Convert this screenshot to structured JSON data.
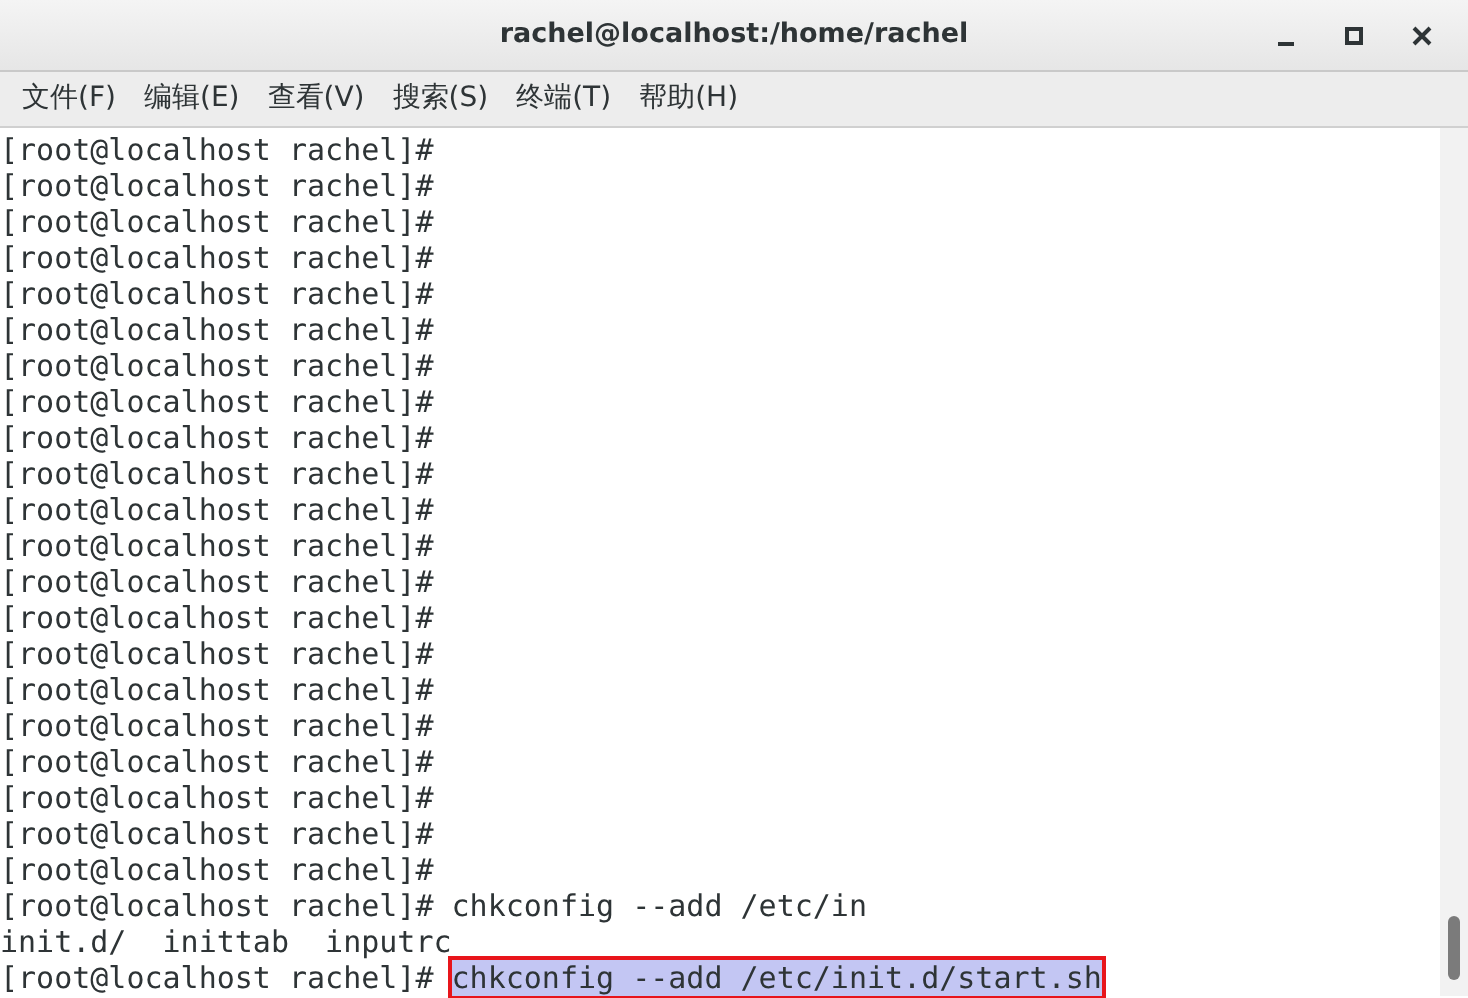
{
  "window": {
    "title": "rachel@localhost:/home/rachel"
  },
  "menu": [
    {
      "label": "文件(F)"
    },
    {
      "label": "编辑(E)"
    },
    {
      "label": "查看(V)"
    },
    {
      "label": "搜索(S)"
    },
    {
      "label": "终端(T)"
    },
    {
      "label": "帮助(H)"
    }
  ],
  "terminal": {
    "lines": [
      {
        "text": "[root@localhost rachel]#"
      },
      {
        "text": "[root@localhost rachel]#"
      },
      {
        "text": "[root@localhost rachel]#"
      },
      {
        "text": "[root@localhost rachel]#"
      },
      {
        "text": "[root@localhost rachel]#"
      },
      {
        "text": "[root@localhost rachel]#"
      },
      {
        "text": "[root@localhost rachel]#"
      },
      {
        "text": "[root@localhost rachel]#"
      },
      {
        "text": "[root@localhost rachel]#"
      },
      {
        "text": "[root@localhost rachel]#"
      },
      {
        "text": "[root@localhost rachel]#"
      },
      {
        "text": "[root@localhost rachel]#"
      },
      {
        "text": "[root@localhost rachel]#"
      },
      {
        "text": "[root@localhost rachel]#"
      },
      {
        "text": "[root@localhost rachel]#"
      },
      {
        "text": "[root@localhost rachel]#"
      },
      {
        "text": "[root@localhost rachel]#"
      },
      {
        "text": "[root@localhost rachel]#"
      },
      {
        "text": "[root@localhost rachel]#"
      },
      {
        "text": "[root@localhost rachel]#"
      },
      {
        "text": "[root@localhost rachel]#"
      },
      {
        "text": "[root@localhost rachel]# chkconfig --add /etc/in"
      },
      {
        "text": "init.d/  inittab  inputrc"
      },
      {
        "text": "[root@localhost rachel]#",
        "selected_text": "chkconfig --add /etc/init.d/start.sh"
      }
    ]
  }
}
